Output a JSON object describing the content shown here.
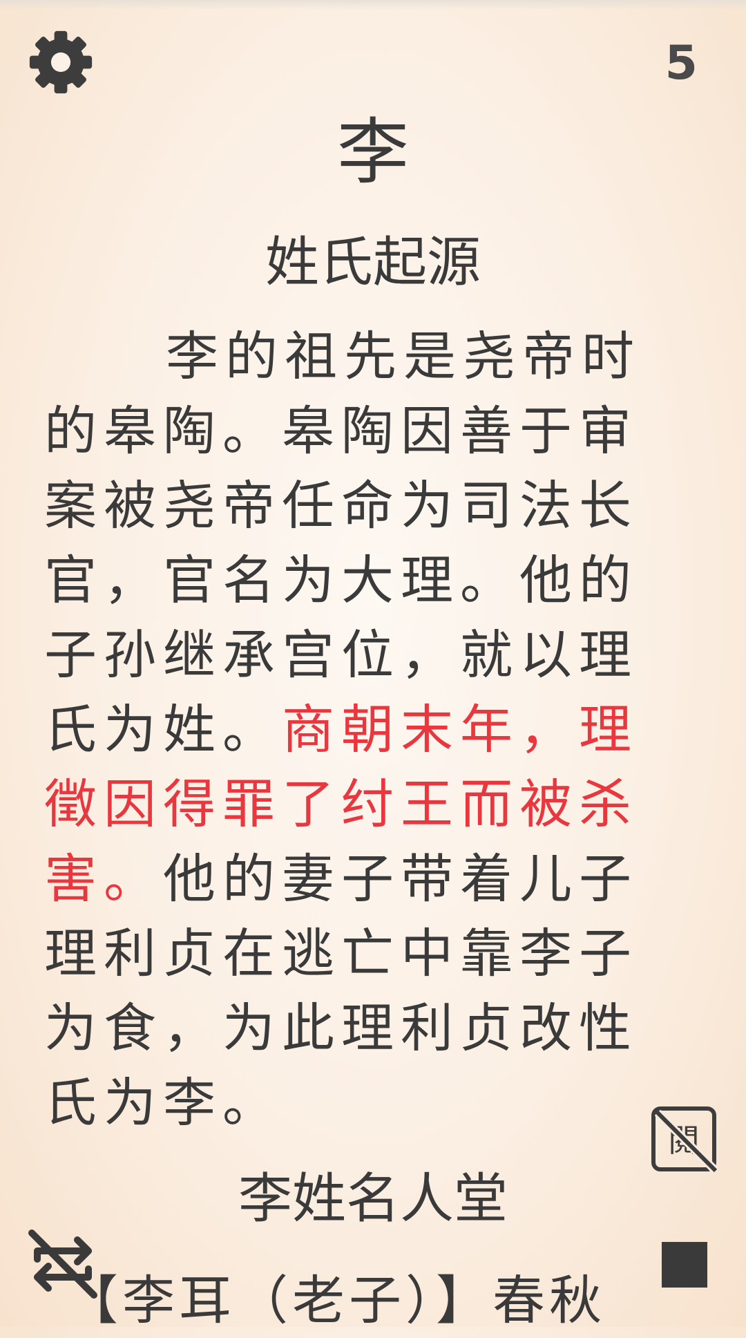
{
  "header": {
    "settings_icon": "gear-icon",
    "page_number": "5"
  },
  "surname": "李",
  "origin": {
    "title": "姓氏起源",
    "text_before": "李的祖先是尧帝时的皋陶。皋陶因善于审案被尧帝任命为司法长官，官名为大理。他的子孙继承宫位，就以理氏为姓。",
    "text_highlight": "商朝末年，理徵因得罪了纣王而被杀害。",
    "text_after": "他的妻子带着儿子理利贞在逃亡中靠李子为食，为此理利贞改性氏为李。",
    "highlight_color": "#e8373e"
  },
  "famous": {
    "title": "李姓名人堂",
    "first_line": "【李耳（老子）】春秋"
  },
  "controls": {
    "read_toggle_icon": "reading-off-icon",
    "shuffle_icon": "shuffle-off-icon",
    "stop_icon": "stop-icon"
  }
}
